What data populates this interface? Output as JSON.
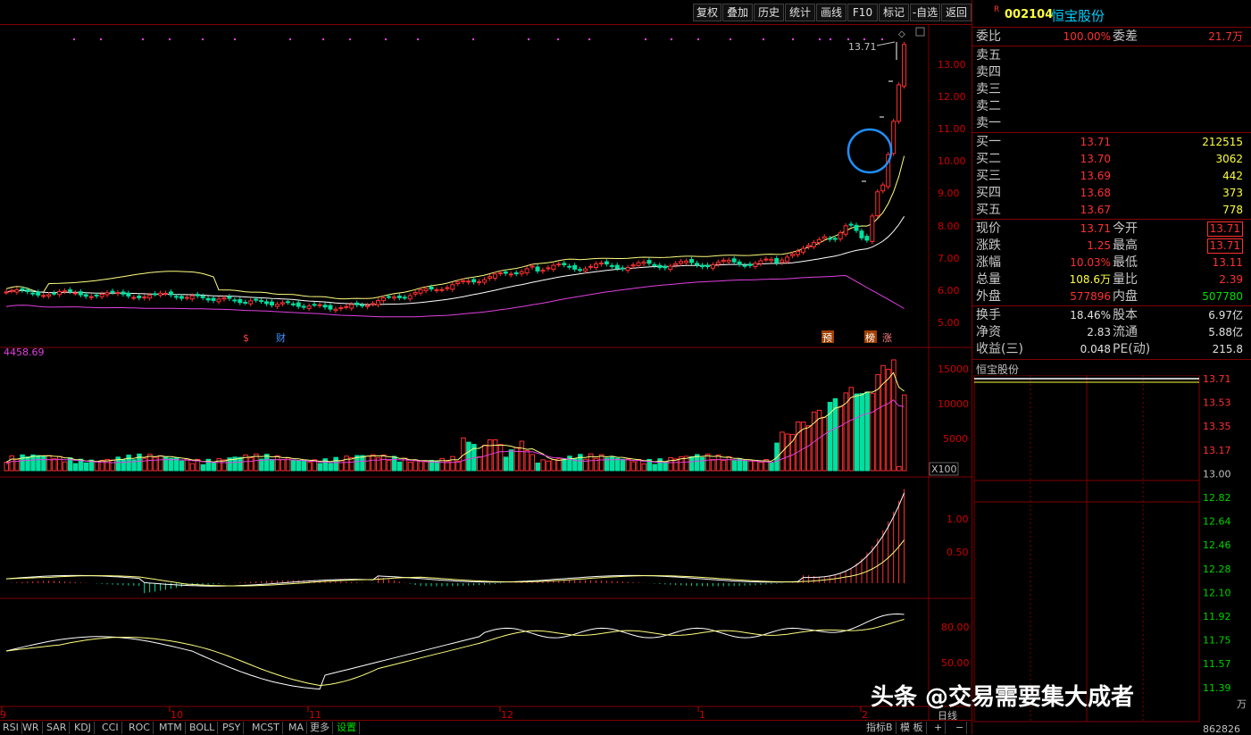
{
  "toolbar": {
    "buttons": [
      "复权",
      "叠加",
      "历史",
      "统计",
      "画线",
      "F10",
      "标记",
      "-自选",
      "返回"
    ]
  },
  "main_chart": {
    "price_axis": [
      "13.00",
      "12.00",
      "11.00",
      "10.00",
      "9.00",
      "8.00",
      "7.00",
      "6.00",
      "5.00"
    ],
    "high_label": "13.71",
    "event_markers": {
      "s": "$",
      "cai": "财",
      "yu": "预",
      "bang": "榜",
      "zhang": "涨"
    },
    "colors": {
      "up": "#ff3030",
      "down": "#00e0a0",
      "ma1": "#ffffa0",
      "ma2": "#ffffff",
      "ma3": "#e040e0"
    }
  },
  "volume_panel": {
    "label": "4458.69",
    "axis": [
      "15000",
      "10000",
      "5000"
    ],
    "unit": "X100"
  },
  "macd_panel": {
    "axis": [
      "1.00",
      "0.50"
    ]
  },
  "kdj_panel": {
    "axis": [
      "80.00",
      "50.00"
    ]
  },
  "date_axis": [
    "9",
    "10",
    "11",
    "12",
    "1",
    "2"
  ],
  "date_axis_suffix": "日线",
  "bottom_tabs": [
    "RSI",
    "WR",
    "SAR",
    "KDJ",
    "CCI",
    "ROC",
    "MTM",
    "BOLL",
    "PSY",
    "MCST",
    "MA",
    "更多",
    "设置"
  ],
  "bottom_right": {
    "indicator": "指标B",
    "template": "模 板",
    "plus": "+",
    "minus": "−"
  },
  "quote": {
    "r_badge": "R",
    "code": "002104",
    "name": "恒宝股份",
    "weibi_label": "委比",
    "weibi_value": "100.00%",
    "weicha_label": "委差",
    "weicha_value": "21.7万",
    "sell": [
      {
        "label": "卖五",
        "price": "",
        "vol": ""
      },
      {
        "label": "卖四",
        "price": "",
        "vol": ""
      },
      {
        "label": "卖三",
        "price": "",
        "vol": ""
      },
      {
        "label": "卖二",
        "price": "",
        "vol": ""
      },
      {
        "label": "卖一",
        "price": "",
        "vol": ""
      }
    ],
    "buy": [
      {
        "label": "买一",
        "price": "13.71",
        "vol": "212515"
      },
      {
        "label": "买二",
        "price": "13.70",
        "vol": "3062"
      },
      {
        "label": "买三",
        "price": "13.69",
        "vol": "442"
      },
      {
        "label": "买四",
        "price": "13.68",
        "vol": "373"
      },
      {
        "label": "买五",
        "price": "13.67",
        "vol": "778"
      }
    ],
    "stats": [
      {
        "l1": "现价",
        "v1": "13.71",
        "c1": "red",
        "l2": "今开",
        "v2": "13.71",
        "c2": "red",
        "box2": true
      },
      {
        "l1": "涨跌",
        "v1": "1.25",
        "c1": "red",
        "l2": "最高",
        "v2": "13.71",
        "c2": "red",
        "box2": true
      },
      {
        "l1": "涨幅",
        "v1": "10.03%",
        "c1": "red",
        "l2": "最低",
        "v2": "13.11",
        "c2": "red",
        "box2": false
      },
      {
        "l1": "总量",
        "v1": "108.6万",
        "c1": "yellow",
        "l2": "量比",
        "v2": "2.39",
        "c2": "red",
        "box2": false
      },
      {
        "l1": "外盘",
        "v1": "577896",
        "c1": "red",
        "l2": "内盘",
        "v2": "507780",
        "c2": "green",
        "box2": false
      }
    ],
    "fund": [
      {
        "l1": "换手",
        "v1": "18.46%",
        "l2": "股本",
        "v2": "6.97亿"
      },
      {
        "l1": "净资",
        "v1": "2.83",
        "l2": "流通",
        "v2": "5.88亿"
      },
      {
        "l1": "收益(三)",
        "v1": "0.048",
        "l2": "PE(动)",
        "v2": "215.8"
      }
    ]
  },
  "intraday": {
    "title": "恒宝股份",
    "axis": [
      "13.71",
      "13.53",
      "13.35",
      "13.17",
      "13.00",
      "12.82",
      "12.64",
      "12.46",
      "12.28",
      "12.10",
      "11.92",
      "11.75",
      "11.57",
      "11.39"
    ],
    "bottom_label": "862826",
    "unit": "万"
  },
  "watermark": "头条 @交易需要集大成者"
}
